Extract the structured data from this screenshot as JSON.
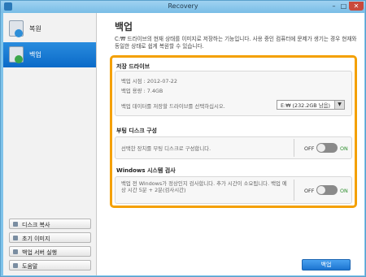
{
  "window": {
    "title": "Recovery",
    "controls": {
      "min": "–",
      "max": "□",
      "close": "✕"
    }
  },
  "sidebar": {
    "items": [
      {
        "label": "복원",
        "icon": "restore-icon"
      },
      {
        "label": "백업",
        "icon": "backup-icon"
      }
    ],
    "tools": [
      {
        "label": "디스크 복사",
        "icon": "disk-copy-icon"
      },
      {
        "label": "초기 이미지",
        "icon": "initial-image-icon"
      },
      {
        "label": "백업 서버 실행",
        "icon": "backup-server-icon"
      },
      {
        "label": "도움말",
        "icon": "help-icon"
      }
    ]
  },
  "main": {
    "title": "백업",
    "desc": "C:₩ 드라이브의 현재 상태를 이미지로 저장하는 기능입니다. 사용 중인 컴퓨터에 문제가 생기는 경우 현재와 동일한 상태로 쉽게 복원할 수 있습니다.",
    "storage": {
      "title": "저장 드라이브",
      "backup_time": "백업 시점 : 2012-07-22",
      "backup_size": "백업 용량 : 7.4GB",
      "select_prompt": "백업 데이터를 저장할 드라이브를 선택하십시오.",
      "selected_drive": "E:₩ (232.2GB 남음)"
    },
    "boot_disk": {
      "title": "부팅 디스크 구성",
      "desc": "선택한 장치를 부팅 디스크로 구성합니다.",
      "toggle_off": "OFF",
      "toggle_on": "ON"
    },
    "windows_check": {
      "title": "Windows 시스템 검사",
      "desc": "백업 전 Windows가 정상인지 검사합니다. 추가 시간이 소요됩니다. 백업 예상 시간 5분 + 2분(검사시간)",
      "toggle_off": "OFF",
      "toggle_on": "ON"
    },
    "backup_button": "백업"
  },
  "colors": {
    "accent": "#1c74d0",
    "highlight": "#f4a000",
    "selected_nav": "#0a6ac8"
  }
}
